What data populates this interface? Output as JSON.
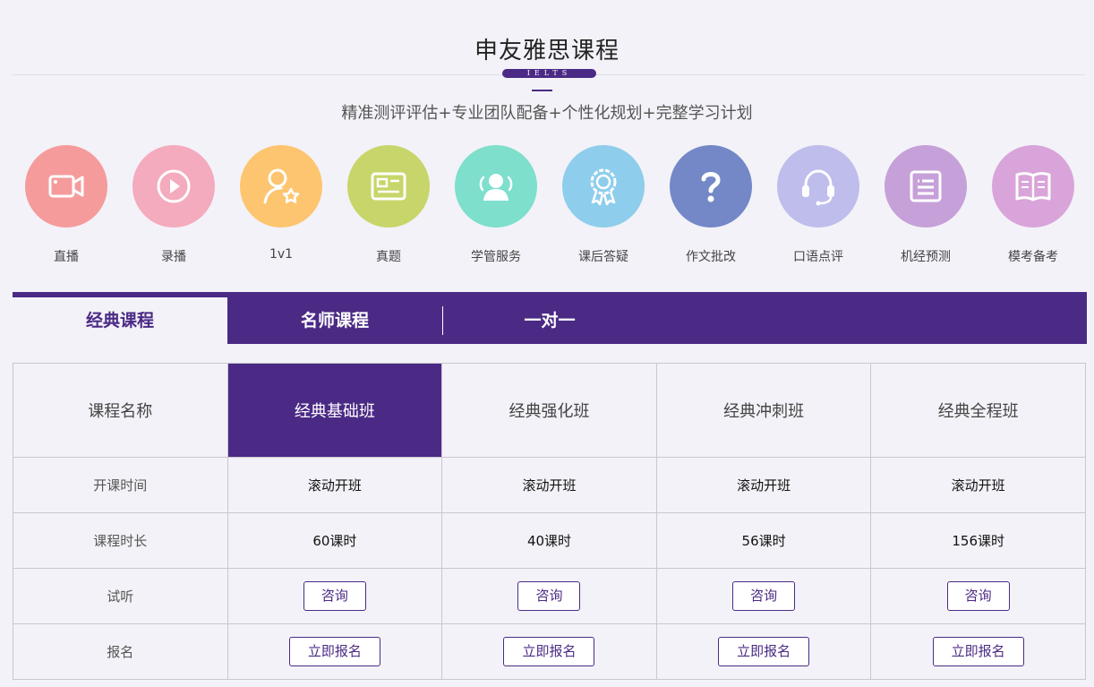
{
  "header": {
    "title": "申友雅思课程",
    "badge": "IELTS",
    "subtitle": "精准测评评估+专业团队配备+个性化规划+完整学习计划"
  },
  "services": [
    {
      "label": "直播",
      "icon": "video-camera-icon",
      "color": "#f59b9b"
    },
    {
      "label": "录播",
      "icon": "play-icon",
      "color": "#f4abbd"
    },
    {
      "label": "1v1",
      "icon": "user-star-icon",
      "color": "#fdc56f"
    },
    {
      "label": "真题",
      "icon": "id-card-icon",
      "color": "#c8d56a"
    },
    {
      "label": "学管服务",
      "icon": "team-icon",
      "color": "#7ddfcc"
    },
    {
      "label": "课后答疑",
      "icon": "award-icon",
      "color": "#8ecdec"
    },
    {
      "label": "作文批改",
      "icon": "question-icon",
      "color": "#7488c8"
    },
    {
      "label": "口语点评",
      "icon": "headset-icon",
      "color": "#bfbdec"
    },
    {
      "label": "机经预测",
      "icon": "document-icon",
      "color": "#c6a0d8"
    },
    {
      "label": "模考备考",
      "icon": "book-icon",
      "color": "#d9a4d9"
    }
  ],
  "tabs": [
    {
      "label": "经典课程",
      "active": true
    },
    {
      "label": "名师课程",
      "active": false
    },
    {
      "label": "一对一",
      "active": false
    }
  ],
  "table": {
    "row_headers": [
      "课程名称",
      "开课时间",
      "课程时长",
      "试听",
      "报名"
    ],
    "courses": [
      {
        "name": "经典基础班",
        "start": "滚动开班",
        "duration": "60课时",
        "trial": "咨询",
        "signup": "立即报名"
      },
      {
        "name": "经典强化班",
        "start": "滚动开班",
        "duration": "40课时",
        "trial": "咨询",
        "signup": "立即报名"
      },
      {
        "name": "经典冲刺班",
        "start": "滚动开班",
        "duration": "56课时",
        "trial": "咨询",
        "signup": "立即报名"
      },
      {
        "name": "经典全程班",
        "start": "滚动开班",
        "duration": "156课时",
        "trial": "咨询",
        "signup": "立即报名"
      }
    ]
  },
  "colors": {
    "accent": "#4b2a85",
    "background": "#f3f2f8"
  }
}
